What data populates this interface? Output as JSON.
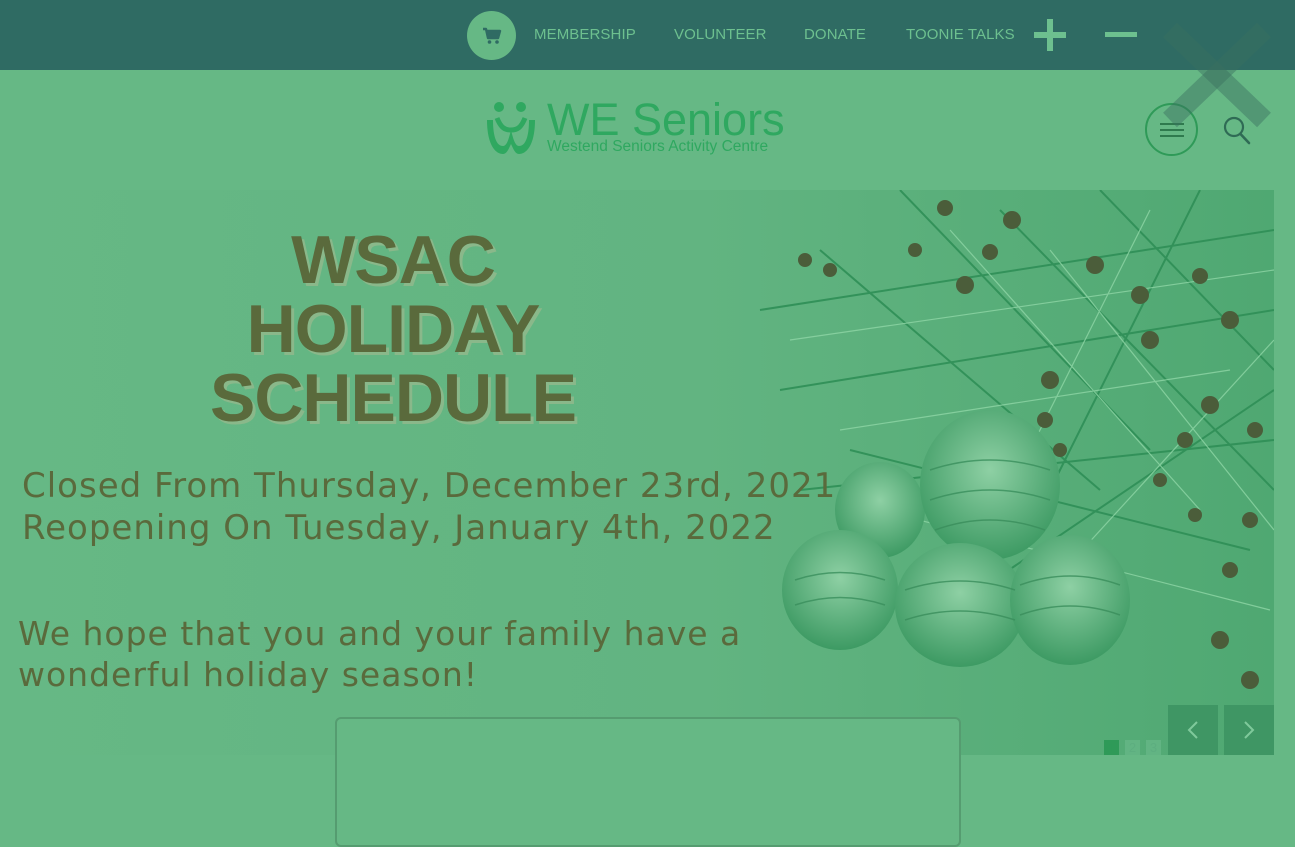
{
  "topbar": {
    "cart_icon": "cart-icon",
    "links": [
      "MEMBERSHIP",
      "VOLUNTEER",
      "DONATE",
      "TOONIE TALKS"
    ],
    "zoom_in_icon": "plus-icon",
    "zoom_out_icon": "minus-icon",
    "close_icon": "close-icon"
  },
  "header": {
    "logo_title": "WE Seniors",
    "logo_subtitle": "Westend Seniors Activity Centre",
    "menu_icon": "hamburger-icon",
    "search_icon": "search-icon"
  },
  "hero": {
    "title_lines": [
      "WSAC",
      "HOLIDAY",
      "SCHEDULE"
    ],
    "line1": "Closed From Thursday, December 23rd, 2021",
    "line2": "Reopening On Tuesday, January 4th, 2022",
    "line3": "We hope that you and your family have a",
    "line4": "wonderful holiday season!",
    "slides": [
      "1",
      "2",
      "3"
    ],
    "active_slide": 1,
    "prev_icon": "chevron-left-icon",
    "next_icon": "chevron-right-icon"
  },
  "colors": {
    "topbar_bg": "#2f6b63",
    "page_bg": "#66b885",
    "accent_green": "#2fa860",
    "text_olive": "#5a6a3c"
  }
}
